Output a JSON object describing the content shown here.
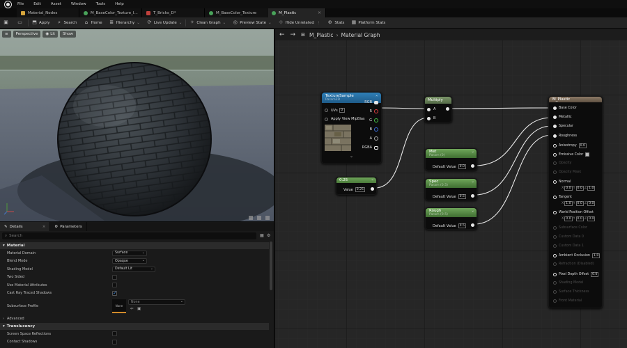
{
  "menu": [
    "File",
    "Edit",
    "Asset",
    "Window",
    "Tools",
    "Help"
  ],
  "tabs": [
    {
      "label": "Material_Nodes",
      "color": "#d6a53c"
    },
    {
      "label": "M_BaseColor_Texture_I...",
      "color": "#49a35a"
    },
    {
      "label": "T_Bricks_D*",
      "color": "#c0413d"
    },
    {
      "label": "M_BaseColor_Texture",
      "color": "#49a35a"
    },
    {
      "label": "M_Plastic",
      "color": "#49a35a"
    }
  ],
  "toolbar": {
    "apply": "Apply",
    "search": "Search",
    "home": "Home",
    "hierarchy": "Hierarchy",
    "live_update": "Live Update",
    "clean_graph": "Clean Graph",
    "preview_state": "Preview State",
    "hide_unrelated": "Hide Unrelated",
    "stats": "Stats",
    "platform_stats": "Platform Stats"
  },
  "viewport": {
    "perspective": "Perspective",
    "lit": "Lit",
    "show": "Show"
  },
  "details": {
    "tab_details": "Details",
    "tab_parameters": "Parameters",
    "search_placeholder": "Search",
    "cat_material": "Material",
    "material_domain": {
      "label": "Material Domain",
      "value": "Surface"
    },
    "blend_mode": {
      "label": "Blend Mode",
      "value": "Opaque"
    },
    "shading_model": {
      "label": "Shading Model",
      "value": "Default Lit"
    },
    "two_sided": "Two Sided",
    "use_material_attributes": "Use Material Attributes",
    "cast_ray_traced_shadows": "Cast Ray Traced Shadows",
    "subsurface_profile": {
      "label": "Subsurface Profile",
      "thumb": "None",
      "value": "None"
    },
    "advanced": "Advanced",
    "cat_translucency": "Translucency",
    "screen_space_reflections": "Screen Space Reflections",
    "contact_shadows": "Contact Shadows"
  },
  "graph": {
    "breadcrumb_asset": "M_Plastic",
    "breadcrumb_sep": "›",
    "breadcrumb_graph": "Material Graph",
    "texture_sample": {
      "title": "TextureSample",
      "sub": "Param2D",
      "uvs": "UVs",
      "uvs_val": "0",
      "apply_mip": "Apply View MipBias",
      "rgb": "RGB",
      "r": "R",
      "g": "G",
      "b": "B",
      "a": "A",
      "rgba": "RGBA"
    },
    "multiply": {
      "title": "Multiply",
      "a": "A",
      "b": "B"
    },
    "scalar_025": {
      "title": "0.25",
      "value_label": "Value",
      "value": "0.25"
    },
    "met": {
      "title": "Met",
      "sub": "Param (0)",
      "label": "Default Value",
      "value": "0.0"
    },
    "spec": {
      "title": "Spec",
      "sub": "Param (0.5)",
      "label": "Default Value",
      "value": "0.5"
    },
    "rough": {
      "title": "Rough",
      "sub": "Param (0.5)",
      "label": "Default Value",
      "value": "0.5"
    },
    "material": {
      "title": "M_Plastic",
      "pins": [
        {
          "label": "Base Color",
          "on": true
        },
        {
          "label": "Metallic",
          "on": true
        },
        {
          "label": "Specular",
          "on": true
        },
        {
          "label": "Roughness",
          "on": true
        },
        {
          "label": "Anisotropy",
          "on": true,
          "val": "0.0"
        },
        {
          "label": "Emissive Color",
          "on": true,
          "swatch": true
        },
        {
          "label": "Opacity",
          "on": false
        },
        {
          "label": "Opacity Mask",
          "on": false
        },
        {
          "label": "Normal",
          "on": true,
          "vec": [
            "0.0",
            "0.0",
            "1.0"
          ]
        },
        {
          "label": "Tangent",
          "on": true,
          "vec": [
            "1.0",
            "0.0",
            "0.0"
          ]
        },
        {
          "label": "World Position Offset",
          "on": true,
          "vec": [
            "0.0",
            "0.0",
            "0.0"
          ]
        },
        {
          "label": "Subsurface Color",
          "on": false
        },
        {
          "label": "Custom Data 0",
          "on": false
        },
        {
          "label": "Custom Data 1",
          "on": false
        },
        {
          "label": "Ambient Occlusion",
          "on": true,
          "val": "1.0"
        },
        {
          "label": "Refraction (Disabled)",
          "on": false
        },
        {
          "label": "Pixel Depth Offset",
          "on": true,
          "val": "0.0"
        },
        {
          "label": "Shading Model",
          "on": false
        },
        {
          "label": "Surface Thickness",
          "on": false
        },
        {
          "label": "Front Material",
          "on": false
        }
      ],
      "vec_axes": [
        "X",
        "Y",
        "Z"
      ]
    }
  }
}
